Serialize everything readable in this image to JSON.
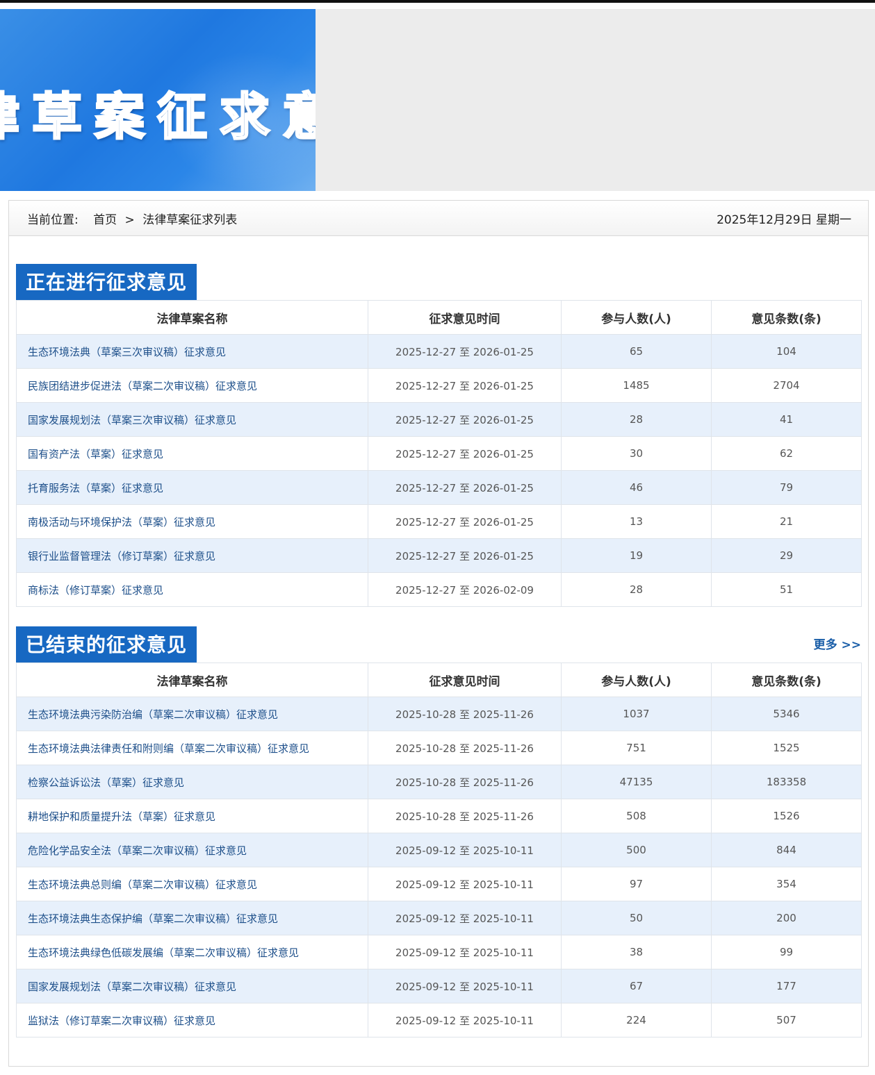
{
  "banner": {
    "title": "律草案征求意"
  },
  "breadcrumb": {
    "label": "当前位置:",
    "home": "首页",
    "separator": ">",
    "current": "法律草案征求列表",
    "date": "2025年12月29日 星期一"
  },
  "columns": [
    "法律草案名称",
    "征求意见时间",
    "参与人数(人)",
    "意见条数(条)"
  ],
  "ongoing": {
    "title": "正在进行征求意见",
    "rows": [
      {
        "name": "生态环境法典（草案三次审议稿）征求意见",
        "period": "2025-12-27 至 2026-01-25",
        "participants": "65",
        "comments": "104"
      },
      {
        "name": "民族团结进步促进法（草案二次审议稿）征求意见",
        "period": "2025-12-27 至 2026-01-25",
        "participants": "1485",
        "comments": "2704"
      },
      {
        "name": "国家发展规划法（草案三次审议稿）征求意见",
        "period": "2025-12-27 至 2026-01-25",
        "participants": "28",
        "comments": "41"
      },
      {
        "name": "国有资产法（草案）征求意见",
        "period": "2025-12-27 至 2026-01-25",
        "participants": "30",
        "comments": "62"
      },
      {
        "name": "托育服务法（草案）征求意见",
        "period": "2025-12-27 至 2026-01-25",
        "participants": "46",
        "comments": "79"
      },
      {
        "name": "南极活动与环境保护法（草案）征求意见",
        "period": "2025-12-27 至 2026-01-25",
        "participants": "13",
        "comments": "21"
      },
      {
        "name": "银行业监督管理法（修订草案）征求意见",
        "period": "2025-12-27 至 2026-01-25",
        "participants": "19",
        "comments": "29"
      },
      {
        "name": "商标法（修订草案）征求意见",
        "period": "2025-12-27 至 2026-02-09",
        "participants": "28",
        "comments": "51"
      }
    ]
  },
  "ended": {
    "title": "已结束的征求意见",
    "more": "更多 >>",
    "rows": [
      {
        "name": "生态环境法典污染防治编（草案二次审议稿）征求意见",
        "period": "2025-10-28 至 2025-11-26",
        "participants": "1037",
        "comments": "5346"
      },
      {
        "name": "生态环境法典法律责任和附则编（草案二次审议稿）征求意见",
        "period": "2025-10-28 至 2025-11-26",
        "participants": "751",
        "comments": "1525"
      },
      {
        "name": "检察公益诉讼法（草案）征求意见",
        "period": "2025-10-28 至 2025-11-26",
        "participants": "47135",
        "comments": "183358"
      },
      {
        "name": "耕地保护和质量提升法（草案）征求意见",
        "period": "2025-10-28 至 2025-11-26",
        "participants": "508",
        "comments": "1526"
      },
      {
        "name": "危险化学品安全法（草案二次审议稿）征求意见",
        "period": "2025-09-12 至 2025-10-11",
        "participants": "500",
        "comments": "844"
      },
      {
        "name": "生态环境法典总则编（草案二次审议稿）征求意见",
        "period": "2025-09-12 至 2025-10-11",
        "participants": "97",
        "comments": "354"
      },
      {
        "name": "生态环境法典生态保护编（草案二次审议稿）征求意见",
        "period": "2025-09-12 至 2025-10-11",
        "participants": "50",
        "comments": "200"
      },
      {
        "name": "生态环境法典绿色低碳发展编（草案二次审议稿）征求意见",
        "period": "2025-09-12 至 2025-10-11",
        "participants": "38",
        "comments": "99"
      },
      {
        "name": "国家发展规划法（草案二次审议稿）征求意见",
        "period": "2025-09-12 至 2025-10-11",
        "participants": "67",
        "comments": "177"
      },
      {
        "name": "监狱法（修订草案二次审议稿）征求意见",
        "period": "2025-09-12 至 2025-10-11",
        "participants": "224",
        "comments": "507"
      }
    ]
  }
}
